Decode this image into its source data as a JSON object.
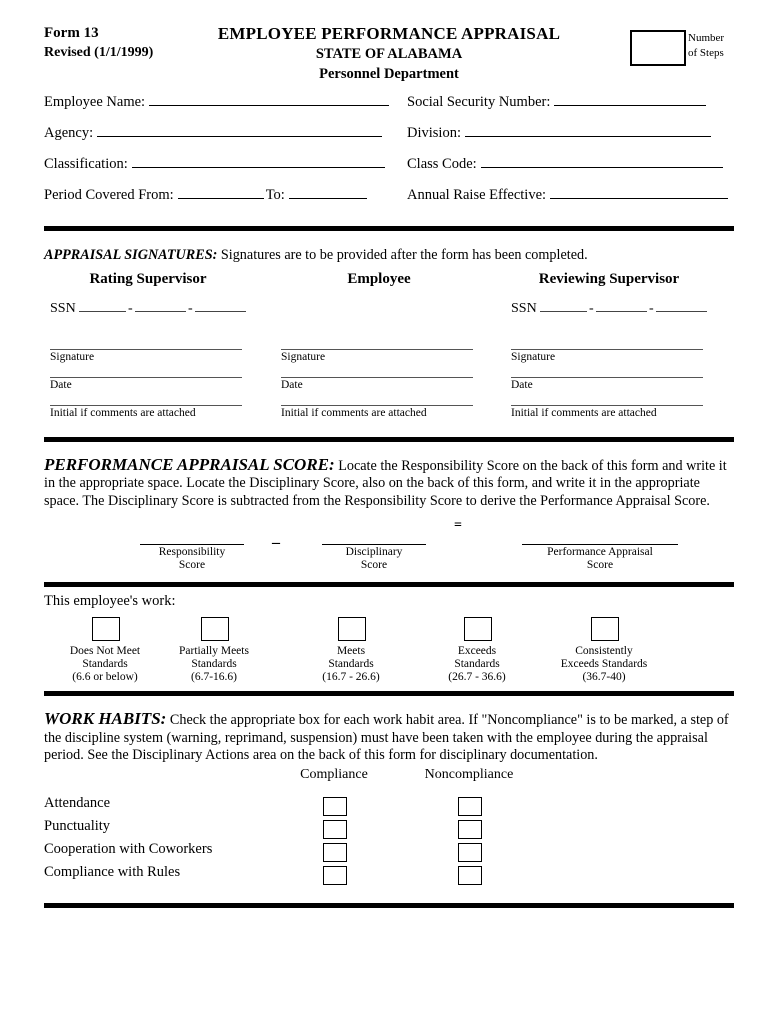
{
  "header": {
    "form_number": "Form 13",
    "revised": "Revised (1/1/1999)",
    "title": "EMPLOYEE PERFORMANCE APPRAISAL",
    "subtitle": "STATE OF ALABAMA",
    "department": "Personnel Department",
    "steps_label_line1": "Number",
    "steps_label_line2": "of Steps",
    "steps_value": ""
  },
  "info_fields": {
    "rows": [
      {
        "left": {
          "label": "Employee Name:",
          "value": ""
        },
        "right": {
          "label": "Social Security Number:",
          "value": ""
        }
      },
      {
        "left": {
          "label": "Agency:",
          "value": ""
        },
        "right": {
          "label": "Division:",
          "value": ""
        }
      },
      {
        "left": {
          "label": "Classification:",
          "value": ""
        },
        "right": {
          "label": "Class Code:",
          "value": ""
        }
      },
      {
        "left": {
          "label": "Period Covered From:",
          "value": "",
          "label2": "To:",
          "value2": ""
        },
        "right": {
          "label": "Annual Raise Effective:",
          "value": ""
        }
      }
    ]
  },
  "signatures_section": {
    "title": "APPRAISAL SIGNATURES:",
    "instruction": "Signatures are to be provided after the form has been completed.",
    "columns": [
      {
        "heading": "Rating Supervisor",
        "ssn_label": "SSN",
        "has_ssn": true,
        "ssn_value_1": "",
        "ssn_value_2": "",
        "ssn_value_3": "",
        "caption_signature": "Signature",
        "caption_date": "Date",
        "caption_initial": "Initial if comments are attached"
      },
      {
        "heading": "Employee",
        "ssn_label": "",
        "has_ssn": false,
        "ssn_value_1": "",
        "ssn_value_2": "",
        "ssn_value_3": "",
        "caption_signature": "Signature",
        "caption_date": "Date",
        "caption_initial": "Initial if comments are attached"
      },
      {
        "heading": "Reviewing Supervisor",
        "ssn_label": "SSN",
        "has_ssn": true,
        "ssn_value_1": "",
        "ssn_value_2": "",
        "ssn_value_3": "",
        "caption_signature": "Signature",
        "caption_date": "Date",
        "caption_initial": "Initial if comments are attached"
      }
    ]
  },
  "score_section": {
    "title": "PERFORMANCE APPRAISAL SCORE:",
    "instruction": "Locate the Responsibility Score on the back of this form and write it in the appropriate space. Locate the Disciplinary Score, also on the back of this form, and write it in the appropriate space. The Disciplinary Score is subtracted from the Responsibility Score to derive the Performance Appraisal Score.",
    "minus_operator": "–",
    "equals_operator": "=",
    "blanks": [
      {
        "caption_line1": "Responsibility",
        "caption_line2": "Score",
        "value": ""
      },
      {
        "caption_line1": "Disciplinary",
        "caption_line2": "Score",
        "value": ""
      },
      {
        "caption_line1": "Performance Appraisal",
        "caption_line2": "Score",
        "value": ""
      }
    ]
  },
  "rating_section": {
    "prompt": "This employee's work:",
    "options": [
      {
        "line1": "Does Not Meet",
        "line2": "Standards",
        "range": "(6.6 or below)",
        "checked": false
      },
      {
        "line1": "Partially Meets",
        "line2": "Standards",
        "range": "(6.7-16.6)",
        "checked": false
      },
      {
        "line1": "Meets",
        "line2": "Standards",
        "range": "(16.7 - 26.6)",
        "checked": false
      },
      {
        "line1": "Exceeds",
        "line2": "Standards",
        "range": "(26.7 - 36.6)",
        "checked": false
      },
      {
        "line1": "Consistently",
        "line2": "Exceeds Standards",
        "range": "(36.7-40)",
        "checked": false
      }
    ]
  },
  "work_habits_section": {
    "title": "WORK HABITS:",
    "instruction": "Check the appropriate box for each work habit area. If \"Noncompliance\" is to be marked, a step of the discipline system (warning, reprimand, suspension) must have been taken with the employee during the appraisal period. See the Disciplinary Actions area on the back of this form for disciplinary documentation.",
    "column_headers": [
      "Compliance",
      "Noncompliance"
    ],
    "rows": [
      {
        "label": "Attendance",
        "compliance": false,
        "noncompliance": false
      },
      {
        "label": "Punctuality",
        "compliance": false,
        "noncompliance": false
      },
      {
        "label": "Cooperation with Coworkers",
        "compliance": false,
        "noncompliance": false
      },
      {
        "label": "Compliance with Rules",
        "compliance": false,
        "noncompliance": false
      }
    ]
  },
  "colors": {
    "ink": "#000000",
    "rule": "#000000",
    "light_rule": "#555555",
    "paper": "#ffffff"
  }
}
